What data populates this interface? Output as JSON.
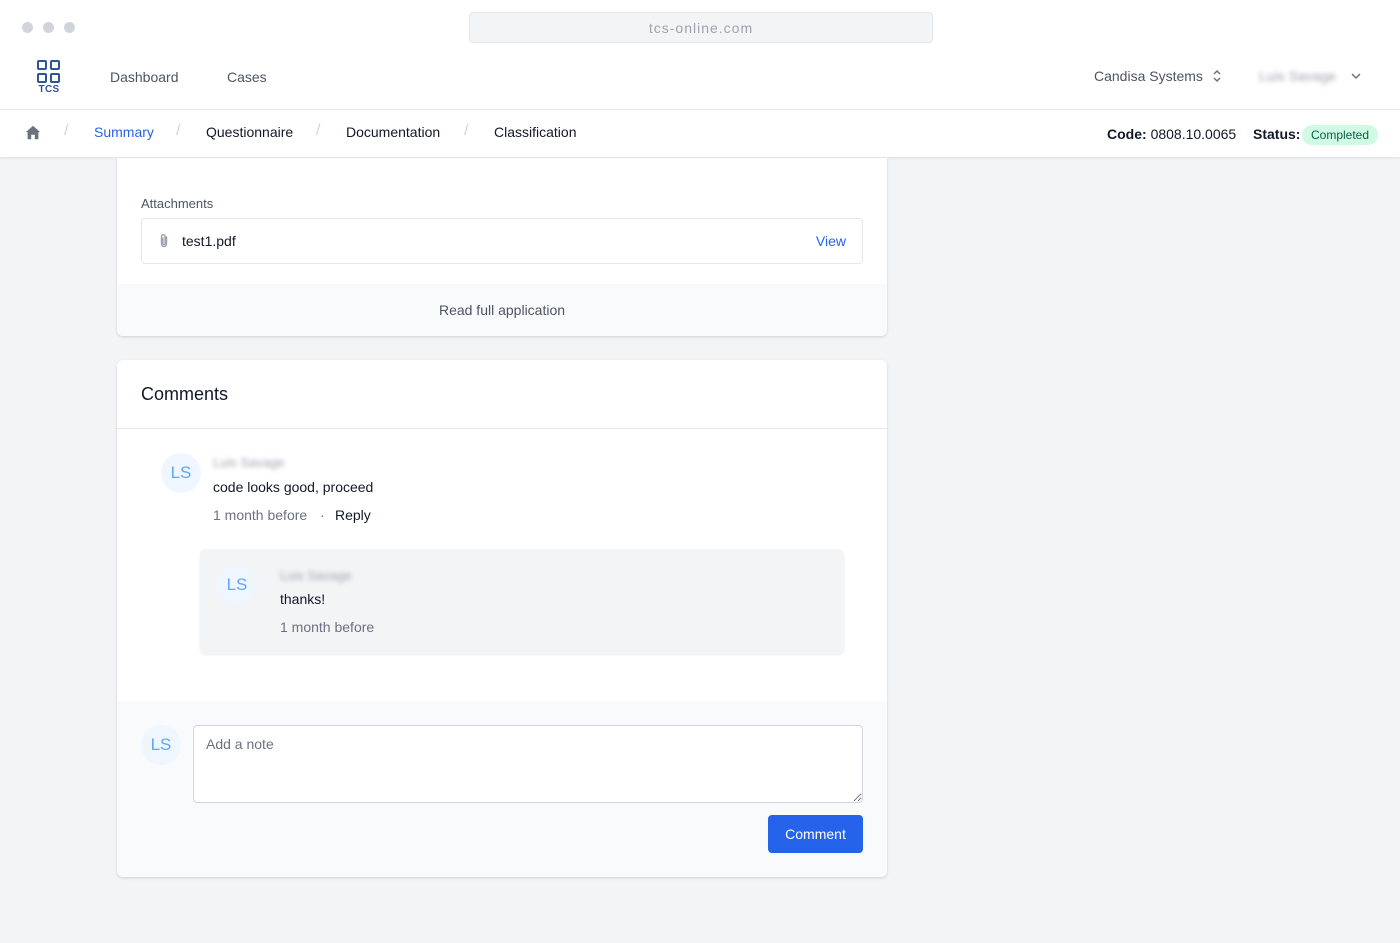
{
  "browser": {
    "url": "tcs-online.com"
  },
  "topnav": {
    "logo_text": "TCS",
    "links": [
      "Dashboard",
      "Cases"
    ],
    "org_name": "Candisa Systems",
    "user_name": "Luis Savage"
  },
  "breadcrumb": {
    "items": [
      "Summary",
      "Questionnaire",
      "Documentation",
      "Classification"
    ],
    "active_index": 0,
    "code_label": "Code:",
    "code_value": "0808.10.0065",
    "status_label": "Status:",
    "status_value": "Completed"
  },
  "attachments": {
    "label": "Attachments",
    "file_name": "test1.pdf",
    "view_label": "View",
    "read_full": "Read full application"
  },
  "comments": {
    "title": "Comments",
    "items": [
      {
        "initials": "LS",
        "author": "Luis Savage",
        "text": "code looks good, proceed",
        "time": "1 month before",
        "separator": "·",
        "reply_label": "Reply"
      }
    ],
    "reply": {
      "initials": "LS",
      "author": "Luis Savage",
      "text": "thanks!",
      "time": "1 month before"
    },
    "compose": {
      "initials": "LS",
      "placeholder": "Add a note",
      "button_label": "Comment"
    }
  },
  "colors": {
    "accent": "#2563eb",
    "brand": "#2f5596",
    "status_bg": "#d1fae5",
    "status_text": "#065f46"
  },
  "icons": [
    "home-icon",
    "paperclip-icon",
    "chevron-up-down-icon",
    "chevron-down-icon"
  ]
}
